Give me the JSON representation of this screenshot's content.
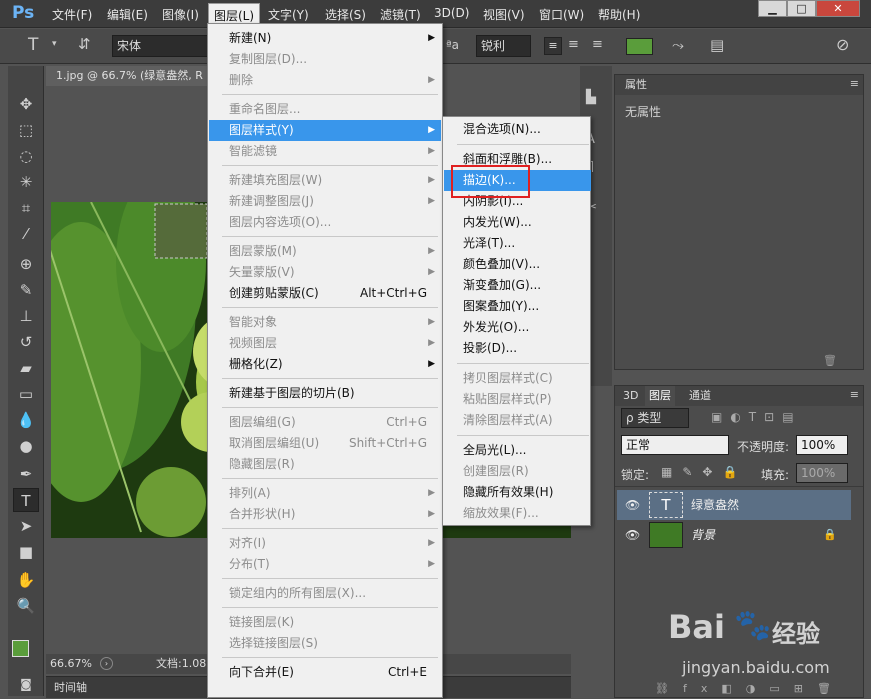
{
  "app": {
    "logo": "Ps"
  },
  "menubar": [
    "文件(F)",
    "编辑(E)",
    "图像(I)",
    "图层(L)",
    "文字(Y)",
    "选择(S)",
    "滤镜(T)",
    "3D(D)",
    "视图(V)",
    "窗口(W)",
    "帮助(H)"
  ],
  "window_buttons": [
    "▁",
    "□",
    "✕"
  ],
  "options": {
    "font_name": "宋体",
    "aa_label": "ªa",
    "aa_mode": "锐利",
    "text_glyph": "T",
    "text_color": "#5a9d3b"
  },
  "document": {
    "tab_title": "1.jpg @ 66.7% (绿意盎然, R",
    "zoom": "66.67%",
    "doc_info": "文档:1.08",
    "timeline": "时间轴"
  },
  "tools": [
    "move-tool",
    "marquee-tool",
    "lasso-tool",
    "magic-wand-tool",
    "crop-tool",
    "eyedropper-tool",
    "healing-tool",
    "brush-tool",
    "stamp-tool",
    "history-brush-tool",
    "eraser-tool",
    "gradient-tool",
    "blur-tool",
    "dodge-tool",
    "pen-tool",
    "type-tool",
    "path-select-tool",
    "shape-tool",
    "hand-tool",
    "zoom-tool"
  ],
  "props_panel": {
    "tab": "属性",
    "text": "无属性"
  },
  "layers_panel": {
    "tabs": [
      "3D",
      "图层",
      "通道"
    ],
    "filter": "ρ 类型",
    "blend_mode": "正常",
    "opacity_label": "不透明度:",
    "opacity": "100%",
    "lock_label": "锁定:",
    "fill_label": "填充:",
    "fill": "100%",
    "layers": [
      {
        "name": "绿意盎然",
        "kind": "text",
        "selected": true
      },
      {
        "name": "背景",
        "kind": "image",
        "selected": false,
        "locked": true
      }
    ]
  },
  "layer_menu": {
    "groups": [
      [
        {
          "label": "新建(N)",
          "sub": true,
          "enabled": true
        },
        {
          "label": "复制图层(D)...",
          "enabled": false
        },
        {
          "label": "删除",
          "sub": true,
          "enabled": false
        }
      ],
      [
        {
          "label": "重命名图层...",
          "enabled": false
        },
        {
          "label": "图层样式(Y)",
          "sub": true,
          "enabled": true,
          "highlight": true
        },
        {
          "label": "智能滤镜",
          "sub": true,
          "enabled": false
        }
      ],
      [
        {
          "label": "新建填充图层(W)",
          "sub": true,
          "enabled": false
        },
        {
          "label": "新建调整图层(J)",
          "sub": true,
          "enabled": false
        },
        {
          "label": "图层内容选项(O)...",
          "enabled": false
        }
      ],
      [
        {
          "label": "图层蒙版(M)",
          "sub": true,
          "enabled": false
        },
        {
          "label": "矢量蒙版(V)",
          "sub": true,
          "enabled": false
        },
        {
          "label": "创建剪贴蒙版(C)",
          "shortcut": "Alt+Ctrl+G",
          "enabled": true
        }
      ],
      [
        {
          "label": "智能对象",
          "sub": true,
          "enabled": false
        },
        {
          "label": "视频图层",
          "sub": true,
          "enabled": false
        },
        {
          "label": "栅格化(Z)",
          "sub": true,
          "enabled": true
        }
      ],
      [
        {
          "label": "新建基于图层的切片(B)",
          "enabled": true
        }
      ],
      [
        {
          "label": "图层编组(G)",
          "shortcut": "Ctrl+G",
          "enabled": false
        },
        {
          "label": "取消图层编组(U)",
          "shortcut": "Shift+Ctrl+G",
          "enabled": false
        },
        {
          "label": "隐藏图层(R)",
          "enabled": false
        }
      ],
      [
        {
          "label": "排列(A)",
          "sub": true,
          "enabled": false
        },
        {
          "label": "合并形状(H)",
          "sub": true,
          "enabled": false
        }
      ],
      [
        {
          "label": "对齐(I)",
          "sub": true,
          "enabled": false
        },
        {
          "label": "分布(T)",
          "sub": true,
          "enabled": false
        }
      ],
      [
        {
          "label": "锁定组内的所有图层(X)...",
          "enabled": false
        }
      ],
      [
        {
          "label": "链接图层(K)",
          "enabled": false
        },
        {
          "label": "选择链接图层(S)",
          "enabled": false
        }
      ],
      [
        {
          "label": "向下合并(E)",
          "shortcut": "Ctrl+E",
          "enabled": true
        }
      ]
    ]
  },
  "style_submenu": {
    "groups": [
      [
        {
          "label": "混合选项(N)...",
          "enabled": true
        }
      ],
      [
        {
          "label": "斜面和浮雕(B)...",
          "enabled": true
        },
        {
          "label": "描边(K)...",
          "enabled": true,
          "highlight": true
        },
        {
          "label": "内阴影(I)...",
          "enabled": true
        },
        {
          "label": "内发光(W)...",
          "enabled": true
        },
        {
          "label": "光泽(T)...",
          "enabled": true
        },
        {
          "label": "颜色叠加(V)...",
          "enabled": true
        },
        {
          "label": "渐变叠加(G)...",
          "enabled": true
        },
        {
          "label": "图案叠加(Y)...",
          "enabled": true
        },
        {
          "label": "外发光(O)...",
          "enabled": true
        },
        {
          "label": "投影(D)...",
          "enabled": true
        }
      ],
      [
        {
          "label": "拷贝图层样式(C)",
          "enabled": false
        },
        {
          "label": "粘贴图层样式(P)",
          "enabled": false
        },
        {
          "label": "清除图层样式(A)",
          "enabled": false
        }
      ],
      [
        {
          "label": "全局光(L)...",
          "enabled": true
        },
        {
          "label": "创建图层(R)",
          "enabled": false
        },
        {
          "label": "隐藏所有效果(H)",
          "enabled": true
        },
        {
          "label": "缩放效果(F)...",
          "enabled": false
        }
      ]
    ]
  },
  "watermark": {
    "brand": "Bai",
    "brand2": "经验",
    "url": "jingyan.baidu.com"
  },
  "colors": {
    "accent": "#3996eb",
    "highlight_box": "#e02020",
    "fg_swatch": "#5a9d3b"
  }
}
